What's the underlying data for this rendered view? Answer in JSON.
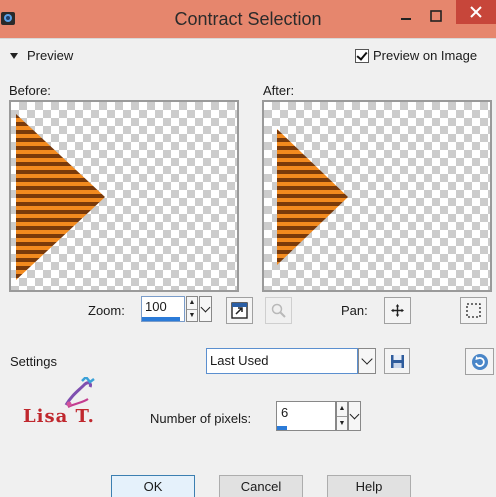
{
  "window": {
    "title": "Contract Selection"
  },
  "preview": {
    "section_label": "Preview",
    "preview_on_image_label": "Preview on Image",
    "preview_on_image_checked": true
  },
  "panels": {
    "before_label": "Before:",
    "after_label": "After:"
  },
  "zoom": {
    "label": "Zoom:",
    "value": "100"
  },
  "pan": {
    "label": "Pan:"
  },
  "settings": {
    "label": "Settings",
    "selected": "Last Used"
  },
  "logo": {
    "text": "Lisa T."
  },
  "pixels": {
    "label": "Number of pixels:",
    "value": "6"
  },
  "buttons": {
    "ok": "OK",
    "cancel": "Cancel",
    "help": "Help"
  },
  "colors": {
    "titlebar": "#e6866d",
    "close": "#c7463a",
    "accent": "#2b7bd8",
    "triangle_orange": "#f28a1e",
    "triangle_dark": "#7a3a0a"
  }
}
